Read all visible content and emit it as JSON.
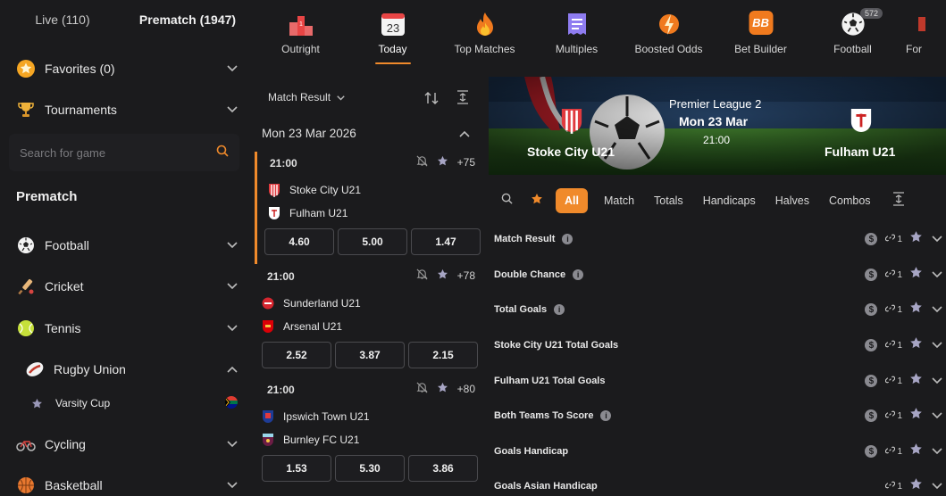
{
  "sidebar": {
    "tabs": [
      {
        "label": "Live (110)"
      },
      {
        "label": "Prematch (1947)"
      }
    ],
    "favorites": "Favorites (0)",
    "tournaments": "Tournaments",
    "search_placeholder": "Search for game",
    "section_title": "Prematch",
    "sports": [
      {
        "label": "Football",
        "icon": "football-icon"
      },
      {
        "label": "Cricket",
        "icon": "cricket-icon"
      },
      {
        "label": "Tennis",
        "icon": "tennis-icon"
      },
      {
        "label": "Rugby Union",
        "icon": "rugby-icon"
      },
      {
        "label": "Varsity Cup",
        "icon": "star-icon"
      },
      {
        "label": "Cycling",
        "icon": "cycling-icon"
      },
      {
        "label": "Basketball",
        "icon": "basketball-icon"
      }
    ]
  },
  "categories": [
    {
      "label": "Outright",
      "icon": "podium-icon"
    },
    {
      "label": "Today",
      "icon": "calendar-icon",
      "day": "23"
    },
    {
      "label": "Top Matches",
      "icon": "fire-icon"
    },
    {
      "label": "Multiples",
      "icon": "ticket-icon"
    },
    {
      "label": "Boosted Odds",
      "icon": "bolt-icon"
    },
    {
      "label": "Bet Builder",
      "icon": "bb-icon",
      "badge_text": "BB"
    },
    {
      "label": "Football",
      "icon": "football-icon",
      "count": "572"
    },
    {
      "label": "For",
      "icon": "flag-icon"
    }
  ],
  "list": {
    "market_select": "Match Result",
    "date": "Mon 23 Mar 2026",
    "matches": [
      {
        "time": "21:00",
        "more": "+75",
        "home": "Stoke City U21",
        "away": "Fulham U21",
        "odds": [
          "4.60",
          "5.00",
          "1.47"
        ]
      },
      {
        "time": "21:00",
        "more": "+78",
        "home": "Sunderland U21",
        "away": "Arsenal U21",
        "odds": [
          "2.52",
          "3.87",
          "2.15"
        ]
      },
      {
        "time": "21:00",
        "more": "+80",
        "home": "Ipswich Town U21",
        "away": "Burnley FC U21",
        "odds": [
          "1.53",
          "5.30",
          "3.86"
        ]
      }
    ]
  },
  "banner": {
    "league": "Premier League 2",
    "date": "Mon 23 Mar",
    "time": "21:00",
    "home": "Stoke City U21",
    "away": "Fulham U21"
  },
  "market_tabs": [
    "All",
    "Match",
    "Totals",
    "Handicaps",
    "Halves",
    "Combos"
  ],
  "markets": [
    {
      "name": "Match Result",
      "info": true,
      "dollar": true,
      "links": "1"
    },
    {
      "name": "Double Chance",
      "info": true,
      "dollar": true,
      "links": "1"
    },
    {
      "name": "Total Goals",
      "info": true,
      "dollar": true,
      "links": "1"
    },
    {
      "name": "Stoke City U21 Total Goals",
      "info": false,
      "dollar": true,
      "links": "1"
    },
    {
      "name": "Fulham U21 Total Goals",
      "info": false,
      "dollar": true,
      "links": "1"
    },
    {
      "name": "Both Teams To Score",
      "info": true,
      "dollar": true,
      "links": "1"
    },
    {
      "name": "Goals Handicap",
      "info": false,
      "dollar": true,
      "links": "1"
    },
    {
      "name": "Goals Asian Handicap",
      "info": false,
      "dollar": false,
      "links": "1"
    }
  ],
  "colors": {
    "accent": "#f08a2b",
    "background": "#1b1b1d",
    "panel": "#1f1f22"
  }
}
